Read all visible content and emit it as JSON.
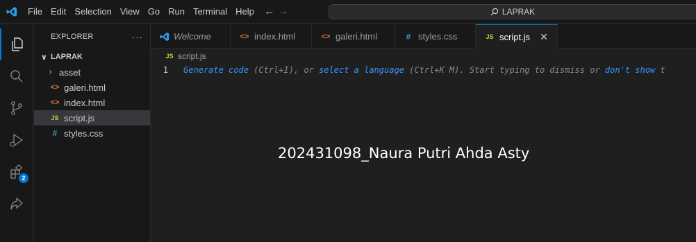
{
  "titlebar": {
    "menu": [
      "File",
      "Edit",
      "Selection",
      "View",
      "Go",
      "Run",
      "Terminal",
      "Help"
    ],
    "search_text": "LAPRAK"
  },
  "activity": {
    "extensions_badge": "2"
  },
  "explorer": {
    "title": "EXPLORER",
    "more": "···",
    "folder": "LAPRAK",
    "items": [
      {
        "label": "asset",
        "kind": "folder"
      },
      {
        "label": "galeri.html",
        "kind": "html"
      },
      {
        "label": "index.html",
        "kind": "html"
      },
      {
        "label": "script.js",
        "kind": "js",
        "selected": true
      },
      {
        "label": "styles.css",
        "kind": "css"
      }
    ]
  },
  "tabs": [
    {
      "label": "Welcome",
      "icon": "vscode-icon"
    },
    {
      "label": "index.html",
      "icon": "html-icon"
    },
    {
      "label": "galeri.html",
      "icon": "html-icon"
    },
    {
      "label": "styles.css",
      "icon": "css-icon"
    },
    {
      "label": "script.js",
      "icon": "js-icon",
      "active": true
    }
  ],
  "icons": {
    "html": "<>",
    "js": "JS",
    "css": "#"
  },
  "editor": {
    "breadcrumb": "script.js",
    "line_number": "1",
    "hint": {
      "p1": "Generate code",
      "p2": " (Ctrl+I), or ",
      "p3": "select a language",
      "p4": " (Ctrl+K M). Start typing to dismiss or ",
      "p5": "don't show",
      "p6": " t"
    }
  },
  "overlay_text": "202431098_Naura Putri Ahda Asty",
  "colors": {
    "accent": "#0078d4",
    "background": "#1f1f1f",
    "sidebar": "#181818",
    "link": "#3794ff"
  }
}
